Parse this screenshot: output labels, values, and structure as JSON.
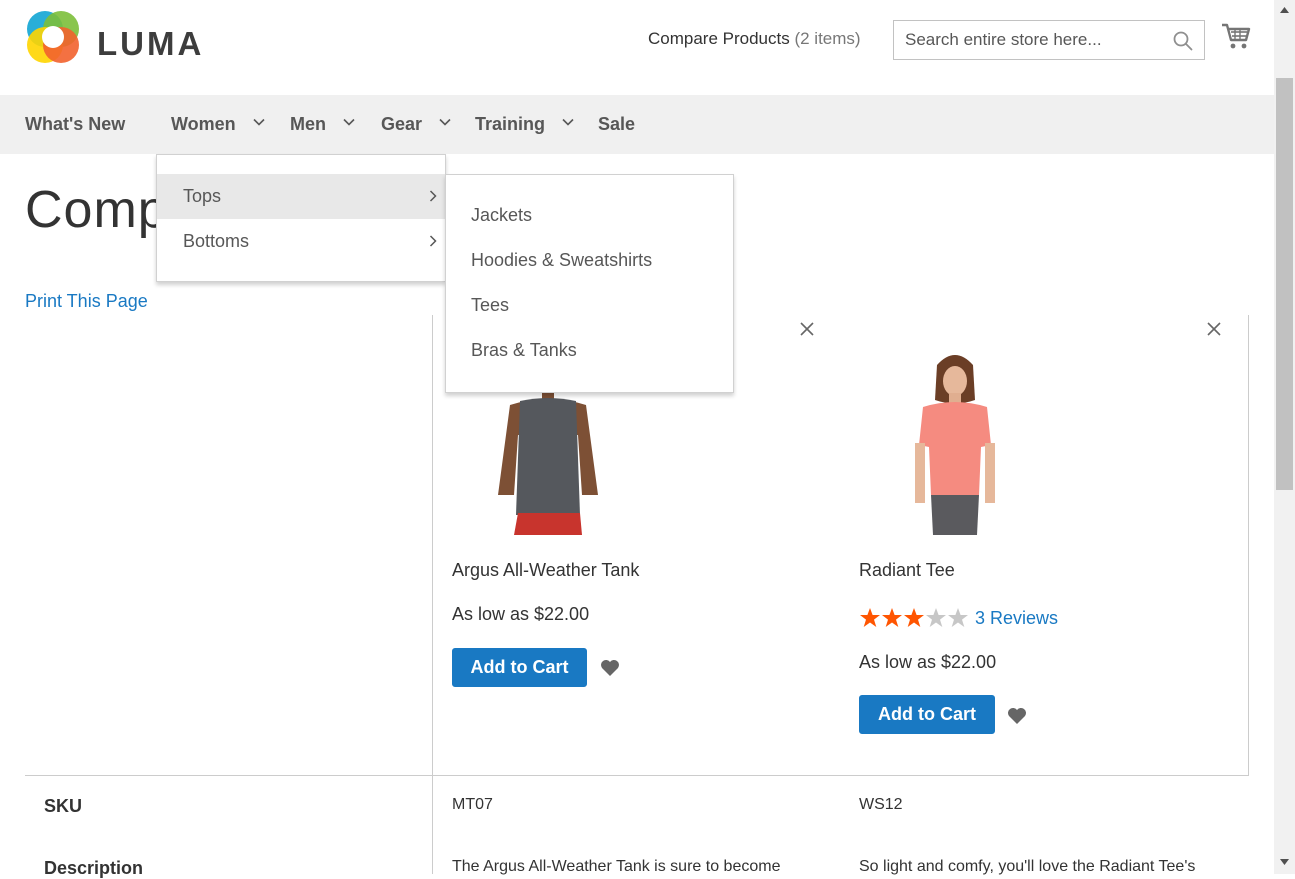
{
  "header": {
    "logo_text": "LUMA",
    "compare_label": "Compare Products",
    "compare_count": "(2 items)",
    "search_placeholder": "Search entire store here..."
  },
  "nav": {
    "items": [
      {
        "label": "What's New",
        "has_dropdown": false
      },
      {
        "label": "Women",
        "has_dropdown": true
      },
      {
        "label": "Men",
        "has_dropdown": true
      },
      {
        "label": "Gear",
        "has_dropdown": true
      },
      {
        "label": "Training",
        "has_dropdown": true
      },
      {
        "label": "Sale",
        "has_dropdown": false
      }
    ]
  },
  "submenu": {
    "items": [
      {
        "label": "Tops",
        "active": true
      },
      {
        "label": "Bottoms",
        "active": false
      }
    ],
    "flyout": [
      "Jackets",
      "Hoodies & Sweatshirts",
      "Tees",
      "Bras & Tanks"
    ]
  },
  "page": {
    "title_visible": "Comp",
    "print_link": "Print This Page"
  },
  "products": [
    {
      "name": "Argus All-Weather Tank",
      "price": "As low as $22.00",
      "add_to_cart": "Add to Cart",
      "sku": "MT07",
      "description": "The Argus All-Weather Tank is sure to become",
      "rating": null
    },
    {
      "name": "Radiant Tee",
      "price": "As low as $22.00",
      "add_to_cart": "Add to Cart",
      "sku": "WS12",
      "description": "So light and comfy, you'll love the Radiant Tee's",
      "rating": {
        "stars": 3,
        "max": 5,
        "reviews_label": "3 Reviews"
      }
    }
  ],
  "attributes": {
    "sku_label": "SKU",
    "description_label": "Description"
  },
  "colors": {
    "link": "#1979c3",
    "button": "#1979c3",
    "star_active": "#ff5501",
    "star_inactive": "#c7c7c7",
    "nav_bg": "#f0f0f0"
  }
}
